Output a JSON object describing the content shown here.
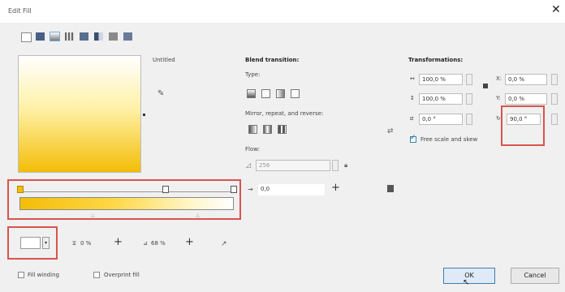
{
  "window": {
    "title": "Edit Fill",
    "close_glyph": "✕"
  },
  "fill_types": [
    "no-fill-icon",
    "uniform-fill-icon",
    "fountain-fill-icon",
    "vector-pattern-icon",
    "bitmap-pattern-icon",
    "two-color-pattern-icon",
    "texture-fill-icon",
    "postscript-fill-icon"
  ],
  "preview": {
    "name": "Untitled"
  },
  "blend": {
    "heading": "Blend transition:",
    "type_label": "Type:",
    "mirror_label": "Mirror, repeat, and reverse:",
    "flow_label": "Flow:",
    "flow_value": "256",
    "accel_value": "0,0"
  },
  "transform": {
    "heading": "Transformations:",
    "width": "100,0 %",
    "height": "100,0 %",
    "x": "0,0 %",
    "y": "0,0 %",
    "skew": "0,0 °",
    "rotate": "90,0 °",
    "free_scale_label": "Free scale and skew"
  },
  "node": {
    "opacity": "0 %",
    "position": "68 %"
  },
  "footer": {
    "fill_winding": "Fill winding",
    "overprint": "Overprint fill",
    "ok": "OK",
    "cancel": "Cancel"
  },
  "colors": {
    "gradient_start": "#f3bd06",
    "gradient_end": "#ffffff",
    "highlight": "#d9534f"
  }
}
